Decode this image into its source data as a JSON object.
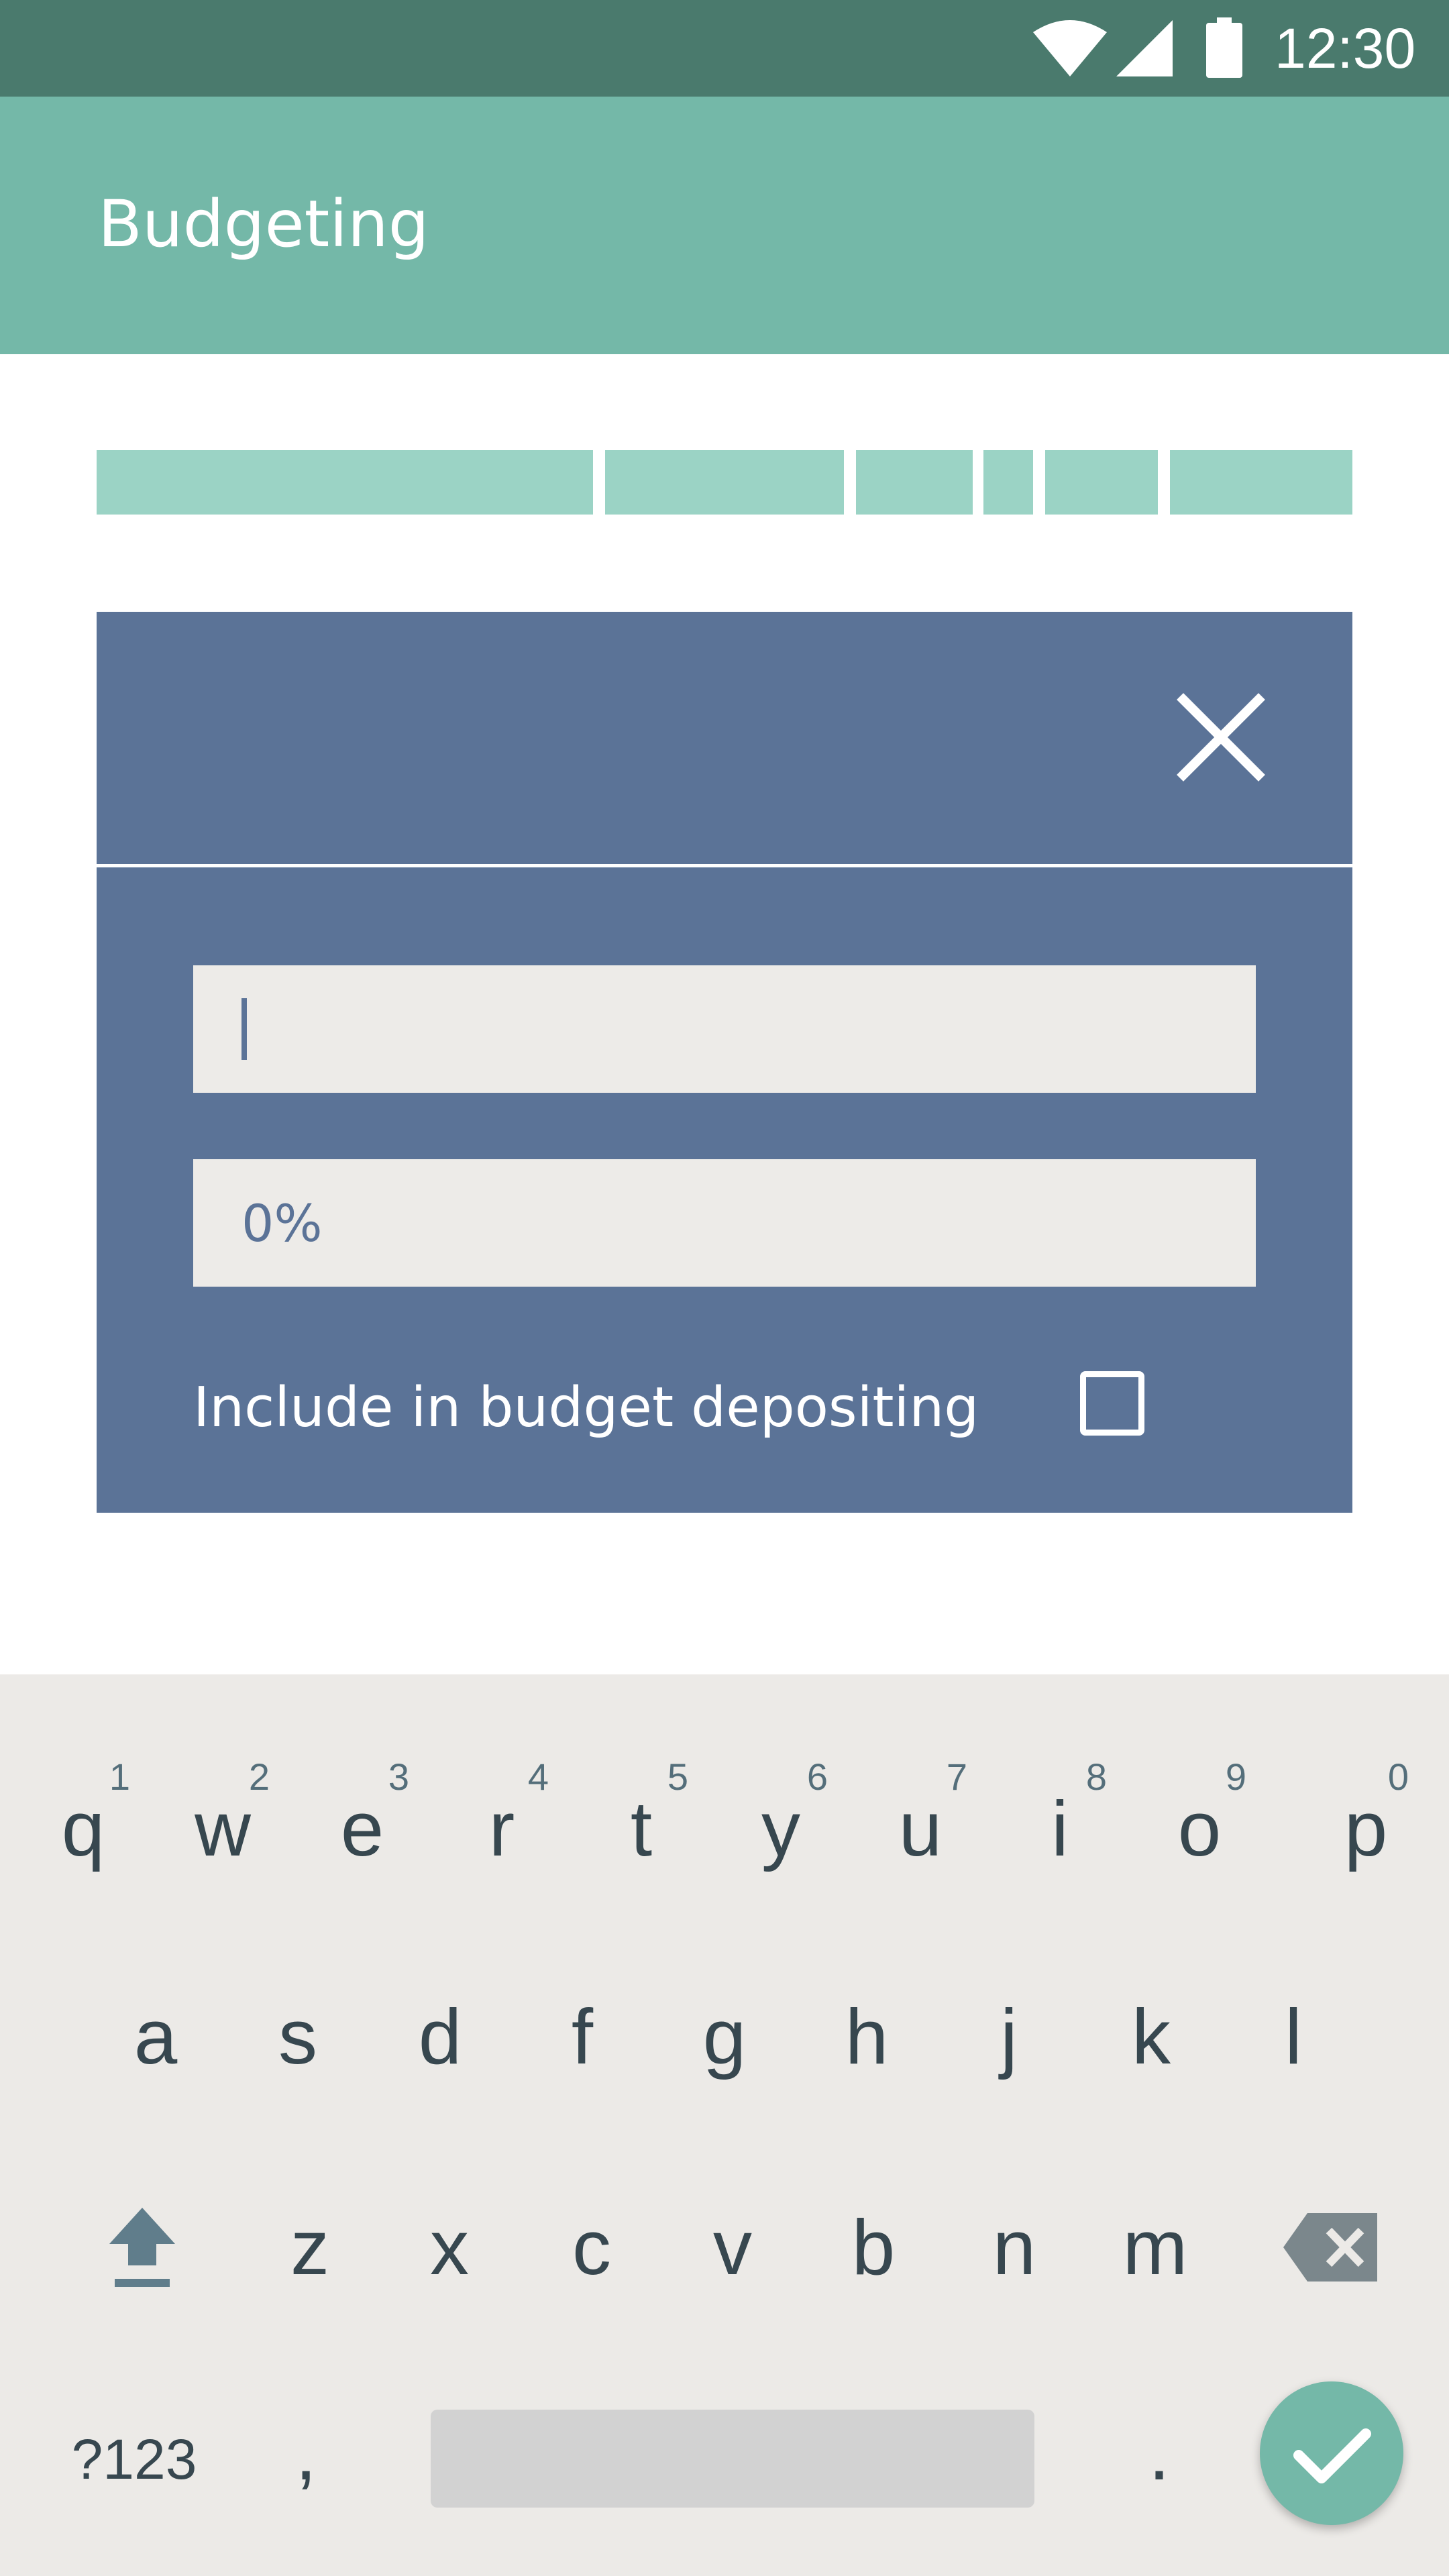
{
  "status_bar": {
    "time": "12:30",
    "icons": [
      "wifi-icon",
      "signal-icon",
      "battery-icon"
    ]
  },
  "app_bar": {
    "title": "Budgeting",
    "background": "#74b8a8"
  },
  "segment_bar": {
    "color": "#9bd3c5"
  },
  "dialog": {
    "background": "#5b7397",
    "close_icon": "close-icon",
    "name_field": {
      "value": "",
      "placeholder": ""
    },
    "percent_field": {
      "placeholder": "0%"
    },
    "include_label": "Include in budget depositing",
    "include_checked": false
  },
  "keyboard": {
    "row1": [
      {
        "key": "q",
        "hint": "1"
      },
      {
        "key": "w",
        "hint": "2"
      },
      {
        "key": "e",
        "hint": "3"
      },
      {
        "key": "r",
        "hint": "4"
      },
      {
        "key": "t",
        "hint": "5"
      },
      {
        "key": "y",
        "hint": "6"
      },
      {
        "key": "u",
        "hint": "7"
      },
      {
        "key": "i",
        "hint": "8"
      },
      {
        "key": "o",
        "hint": "9"
      },
      {
        "key": "p",
        "hint": "0"
      }
    ],
    "row2": [
      "a",
      "s",
      "d",
      "f",
      "g",
      "h",
      "j",
      "k",
      "l"
    ],
    "row3": [
      "z",
      "x",
      "c",
      "v",
      "b",
      "n",
      "m"
    ],
    "symbols_label": "?123",
    "comma": ",",
    "period": ".",
    "shift_icon": "shift-icon",
    "backspace_icon": "backspace-icon",
    "done_icon": "checkmark-icon",
    "accent": "#74b8a8"
  }
}
